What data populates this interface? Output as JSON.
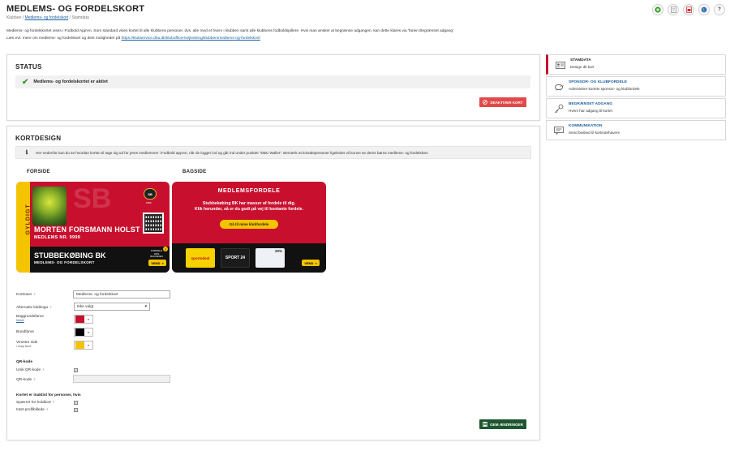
{
  "header": {
    "title": "MEDLEMS- OG FORDELSKORT",
    "breadcrumb": {
      "root": "Klubben",
      "sep1": " / ",
      "link": "Medlems- og fordelskort",
      "sep2": " / ",
      "current": "Stamdata"
    },
    "icons": [
      "add-circle-icon",
      "document-icon",
      "pdf-icon",
      "globe-icon",
      "help-icon"
    ],
    "help_label": "?"
  },
  "intro": {
    "line1": "Medlems- og fordelskortet vises i Fodbold App'en. Som standard vises kortet til alle klubbens personer, dvs. alle med et hverv i klubben samt alle klubbens fodboldspillere. Hvis man ønsker at begrænse adgangen, kan dette klares via 'fanen Begrænset adgang'",
    "line2_prefix": "Læs evt. mere om medlems- og fordelskort og dets muligheder på ",
    "line2_link": "https://klubservice.dbu.dk/klubofficer/vejledning/klubben/medlems-og-fordelskort/"
  },
  "status": {
    "title": "STATUS",
    "message": "Medlems- og fordelskortet er aktivt",
    "deactivate_label": "DEAKTIVER KORT"
  },
  "design": {
    "title": "KORTDESIGN",
    "info": "Her nedenfor kan du se hvordan kortet vil tage sig ud for jeres medlemmer i Fodbold app'en, når de logger ind og går ind under punktet \"DBU Wallet\". Bemærk at kontaktpersoner ligeledes vil kunne se deres børns medlems- og fordelskort.",
    "front_label": "FORSIDE",
    "back_label": "BAGSIDE"
  },
  "card_front": {
    "valid": "GYLDIGT",
    "watermark": "SB",
    "crest_text": "SB",
    "crest_year": "1896",
    "name": "MORTEN FORSMANN HOLST",
    "member_no": "MEDLEMS NR. 9999",
    "club": "STUBBEKØBING BK",
    "club_sub": "MEDLEMS- OG FORDELSKORT",
    "fordele": "FORDELE HOS BAGSIDEN",
    "badge": "?",
    "vend": "VEND"
  },
  "card_back": {
    "title": "MEDLEMSFORDELE",
    "line1": "Stubbekøbing BK har masser af fordele til dig.",
    "line2": "Klik herunder, så er du godt på vej til kontante fordele.",
    "goto": "Gå til mine klubfordele",
    "tile1": "sportsdeal",
    "tile2": "SPORT 24",
    "tile3": "20%",
    "vend": "VEND"
  },
  "form": {
    "kortnavn_label": "Kortnavn",
    "kortnavn_value": "Medlems- og fordelskort",
    "logo_label": "Alternativ klublogo",
    "logo_value": "Ikke valgt",
    "bg_label": "Baggrundsfarve",
    "bg_link": "Nulstil",
    "bg_color": "#c8102e",
    "bund_label": "Bundfarve",
    "bund_color": "#000000",
    "left_label": "Venstre side",
    "left_sub": "• knap farve",
    "left_color": "#f5c400",
    "qr_title": "QR-kode",
    "qr_unique_label": "Unik QR-kode",
    "qr_code_label": "QR-kode",
    "inactive_title": "Kortet er inaktivt for personer, hvis",
    "blocked_label": "Spærret for holdkort",
    "no_photo_label": "Intet profilbillede",
    "help_mark": "?",
    "save_label": "GEM ÆNDRINGER"
  },
  "sidebar": {
    "items": [
      {
        "title": "STAMDATA",
        "desc": "Design dit kort",
        "icon": "id-card-icon",
        "active": true
      },
      {
        "title": "SPONSOR- OG KLUBFORDELE",
        "desc": "Administrer kortets sponsor- og klubfordele",
        "icon": "piggy-bank-icon",
        "active": false
      },
      {
        "title": "BEGRÆNSET ADGANG",
        "desc": "Hvem har adgang til kortet",
        "icon": "key-icon",
        "active": false
      },
      {
        "title": "KOMMUNIKATION",
        "desc": "Send besked til kortindehavere",
        "icon": "message-icon",
        "active": false
      }
    ]
  },
  "colors": {
    "brand_red": "#c8102e",
    "brand_yellow": "#f5c400",
    "save_green": "#1e5630",
    "link_blue": "#1a5fa0"
  }
}
